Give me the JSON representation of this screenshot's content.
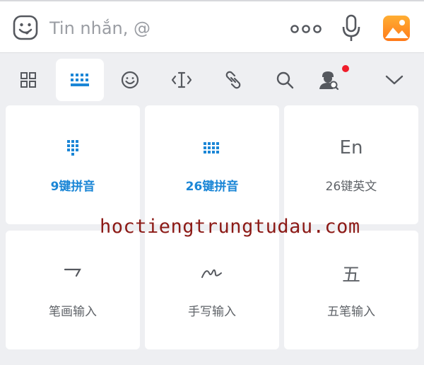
{
  "message_bar": {
    "placeholder": "Tin nhắn, @",
    "icons": [
      "sticker-icon",
      "more-icon",
      "microphone-icon",
      "gallery-icon"
    ]
  },
  "toolbar": {
    "items": [
      "layout-icon",
      "keyboard-icon",
      "emoji-icon",
      "cursor-icon",
      "link-icon",
      "search-icon",
      "user-search-icon",
      "collapse-icon"
    ],
    "active": "keyboard-icon",
    "notification_dot": true
  },
  "input_modes": [
    {
      "label": "9键拼音",
      "icon": "dialpad-icon",
      "selected": true
    },
    {
      "label": "26键拼音",
      "icon": "full-keyboard-icon",
      "selected": true
    },
    {
      "label": "26键英文",
      "icon_text": "En",
      "selected": false
    },
    {
      "label": "笔画输入",
      "icon": "stroke-icon",
      "selected": false
    },
    {
      "label": "手写输入",
      "icon": "handwriting-icon",
      "selected": false
    },
    {
      "label": "五笔输入",
      "icon_text": "五",
      "selected": false
    }
  ],
  "watermark": "hoctiengtrungtudau.com",
  "colors": {
    "accent": "#1b86d6",
    "badge": "#f01d2b",
    "background": "#eeeff2",
    "watermark": "#8c1a16"
  }
}
